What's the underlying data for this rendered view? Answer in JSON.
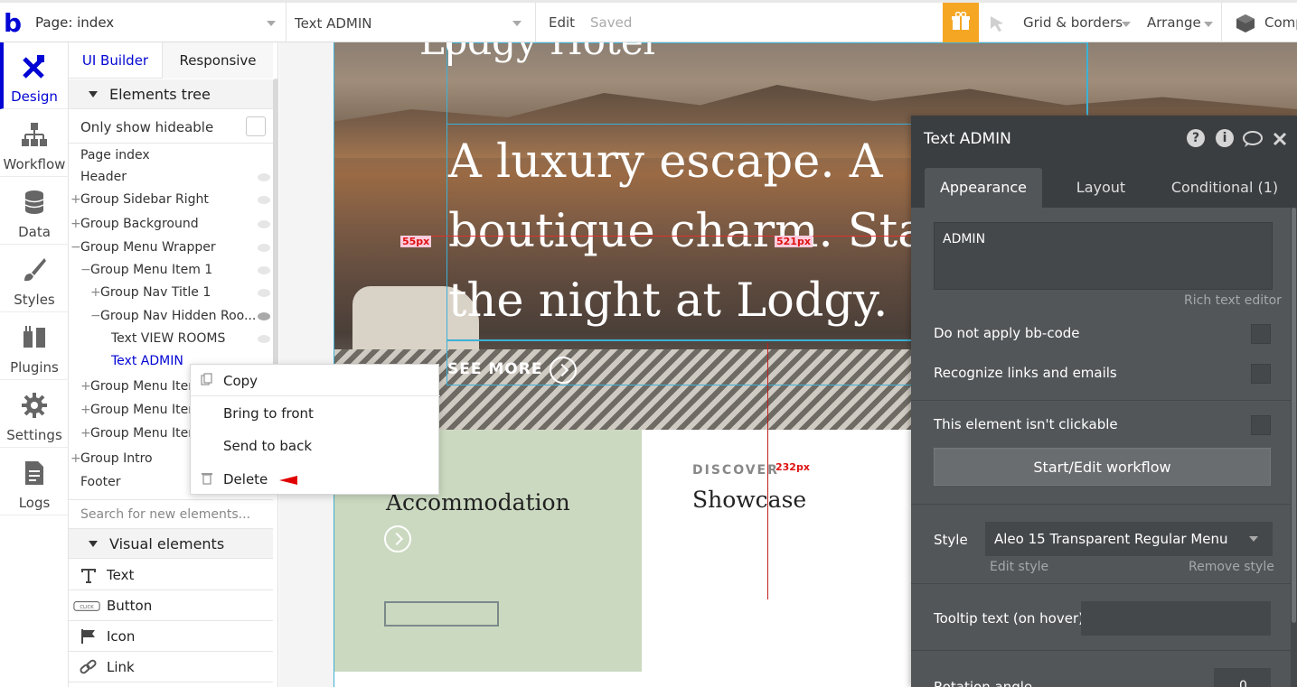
{
  "topbar": {
    "logo": "b",
    "page_label": "Page: index",
    "element_label": "Text ADMIN",
    "edit_label": "Edit",
    "saved_label": "Saved",
    "grid_label": "Grid & borders",
    "arrange_label": "Arrange",
    "comp_label": "Comp"
  },
  "leftnav": {
    "items": [
      {
        "label": "Design"
      },
      {
        "label": "Workflow"
      },
      {
        "label": "Data"
      },
      {
        "label": "Styles"
      },
      {
        "label": "Plugins"
      },
      {
        "label": "Settings"
      },
      {
        "label": "Logs"
      }
    ]
  },
  "panel": {
    "tab_ui": "UI Builder",
    "tab_responsive": "Responsive",
    "elements_tree": "Elements tree",
    "only_hideable": "Only show hideable",
    "tree": [
      {
        "label": "Page index"
      },
      {
        "label": "Header"
      },
      {
        "label": "Group Sidebar Right"
      },
      {
        "label": "Group Background"
      },
      {
        "label": "Group Menu Wrapper"
      },
      {
        "label": "Group Menu Item 1"
      },
      {
        "label": "Group Nav Title 1"
      },
      {
        "label": "Group Nav Hidden Roo..."
      },
      {
        "label": "Text VIEW ROOMS"
      },
      {
        "label": "Text ADMIN"
      },
      {
        "label": "Group Menu Item"
      },
      {
        "label": "Group Menu Item"
      },
      {
        "label": "Group Menu Item"
      },
      {
        "label": "Group Intro"
      },
      {
        "label": "Footer"
      }
    ],
    "search_placeholder": "Search for new elements...",
    "visual_elements": "Visual elements",
    "visual": [
      {
        "label": "Text"
      },
      {
        "label": "Button"
      },
      {
        "label": "Icon"
      },
      {
        "label": "Link"
      }
    ],
    "button_icon_text": "CLICK"
  },
  "canvas": {
    "top_title": "Lodgy Hotel",
    "hero_title": "A luxury escape. A boutique charm. Stay the night at Lodgy.",
    "see_more": "SEE MORE",
    "accom_title": "Accommodation",
    "discover": "DISCOVER",
    "showcase": "Showcase",
    "measure_55": "55px",
    "measure_521": "521px",
    "measure_232": "232px"
  },
  "context_menu": {
    "copy": "Copy",
    "bring_front": "Bring to front",
    "send_back": "Send to back",
    "delete": "Delete"
  },
  "property_editor": {
    "title": "Text ADMIN",
    "tabs": [
      {
        "label": "Appearance"
      },
      {
        "label": "Layout"
      },
      {
        "label": "Conditional (1)"
      }
    ],
    "text_value": "ADMIN",
    "rich_text": "Rich text editor",
    "no_bbcode": "Do not apply bb-code",
    "recognize_links": "Recognize links and emails",
    "not_clickable": "This element isn't clickable",
    "workflow_button": "Start/Edit workflow",
    "style_label": "Style",
    "style_value": "Aleo 15 Transparent Regular Menu",
    "edit_style": "Edit style",
    "remove_style": "Remove style",
    "tooltip_label": "Tooltip text (on hover)",
    "rotation_label": "Rotation angle",
    "rotation_value": "0"
  },
  "colors": {
    "brand": "#0205d3",
    "gift": "#f5a623",
    "editor_bg": "#535659",
    "green_block": "#cbd9c0",
    "annotation_red": "#e00000"
  }
}
